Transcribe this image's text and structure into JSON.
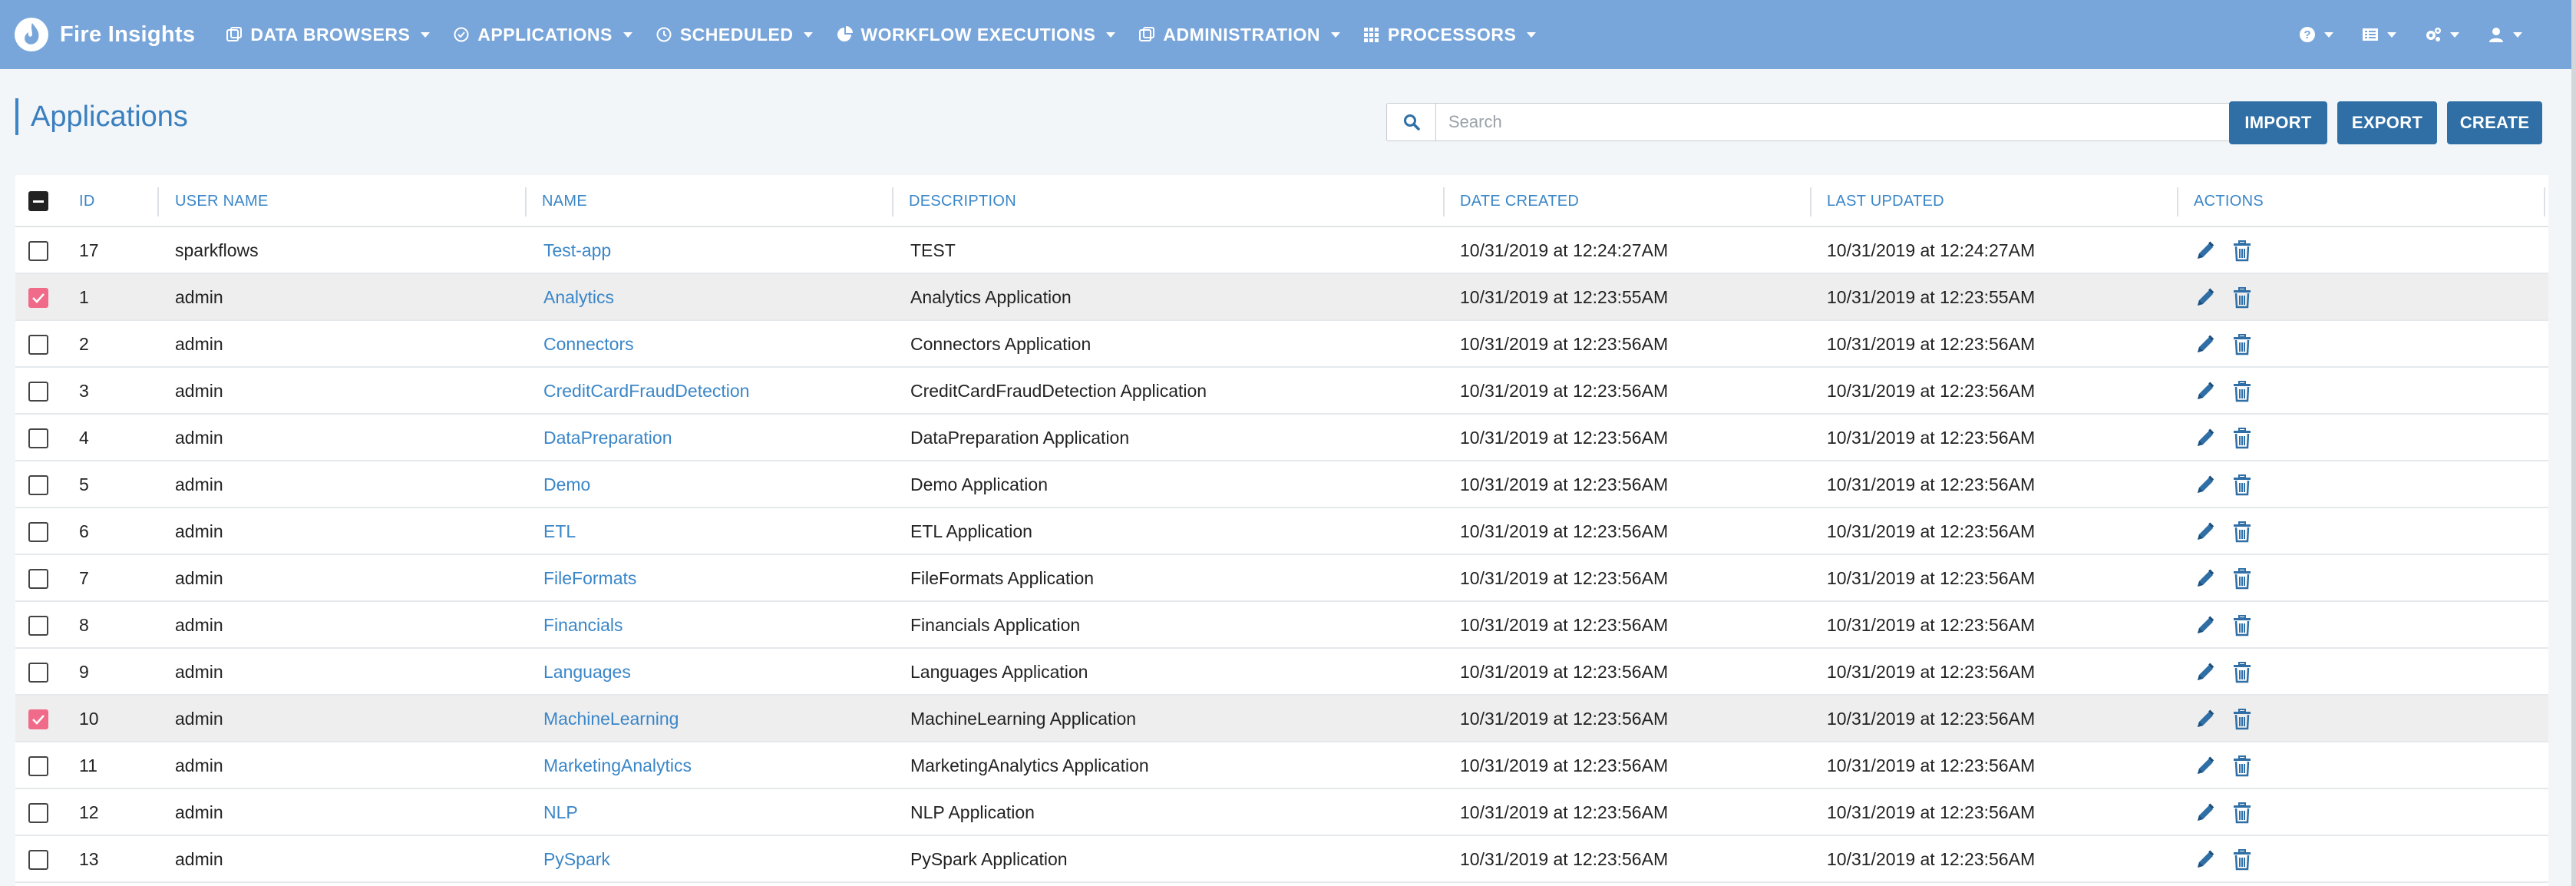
{
  "brand": {
    "name": "Fire Insights"
  },
  "nav": {
    "items": [
      {
        "label": "DATA BROWSERS",
        "icon": "data-browser-icon"
      },
      {
        "label": "APPLICATIONS",
        "icon": "applications-icon"
      },
      {
        "label": "SCHEDULED",
        "icon": "clock-icon"
      },
      {
        "label": "WORKFLOW EXECUTIONS",
        "icon": "pie-chart-icon"
      },
      {
        "label": "ADMINISTRATION",
        "icon": "admin-icon"
      },
      {
        "label": "PROCESSORS",
        "icon": "grid-icon"
      }
    ],
    "right_icons": [
      "help-icon",
      "list-icon",
      "cogs-icon",
      "user-icon"
    ]
  },
  "page": {
    "title": "Applications"
  },
  "search": {
    "placeholder": "Search",
    "value": ""
  },
  "toolbar": {
    "import_label": "IMPORT",
    "export_label": "EXPORT",
    "create_label": "CREATE"
  },
  "colors": {
    "navbar": "#79a6da",
    "accent": "#3a86c8",
    "button": "#2f6fa6",
    "checkbox_checked": "#f06b8a"
  },
  "table": {
    "columns": [
      "ID",
      "USER NAME",
      "NAME",
      "DESCRIPTION",
      "DATE CREATED",
      "LAST UPDATED",
      "ACTIONS"
    ],
    "rows": [
      {
        "id": "17",
        "user": "sparkflows",
        "name": "Test-app",
        "description": "TEST",
        "created": "10/31/2019 at 12:24:27AM",
        "updated": "10/31/2019 at 12:24:27AM",
        "checked": false
      },
      {
        "id": "1",
        "user": "admin",
        "name": "Analytics",
        "description": "Analytics Application",
        "created": "10/31/2019 at 12:23:55AM",
        "updated": "10/31/2019 at 12:23:55AM",
        "checked": true
      },
      {
        "id": "2",
        "user": "admin",
        "name": "Connectors",
        "description": "Connectors Application",
        "created": "10/31/2019 at 12:23:56AM",
        "updated": "10/31/2019 at 12:23:56AM",
        "checked": false
      },
      {
        "id": "3",
        "user": "admin",
        "name": "CreditCardFraudDetection",
        "description": "CreditCardFraudDetection Application",
        "created": "10/31/2019 at 12:23:56AM",
        "updated": "10/31/2019 at 12:23:56AM",
        "checked": false
      },
      {
        "id": "4",
        "user": "admin",
        "name": "DataPreparation",
        "description": "DataPreparation Application",
        "created": "10/31/2019 at 12:23:56AM",
        "updated": "10/31/2019 at 12:23:56AM",
        "checked": false
      },
      {
        "id": "5",
        "user": "admin",
        "name": "Demo",
        "description": "Demo Application",
        "created": "10/31/2019 at 12:23:56AM",
        "updated": "10/31/2019 at 12:23:56AM",
        "checked": false
      },
      {
        "id": "6",
        "user": "admin",
        "name": "ETL",
        "description": "ETL Application",
        "created": "10/31/2019 at 12:23:56AM",
        "updated": "10/31/2019 at 12:23:56AM",
        "checked": false
      },
      {
        "id": "7",
        "user": "admin",
        "name": "FileFormats",
        "description": "FileFormats Application",
        "created": "10/31/2019 at 12:23:56AM",
        "updated": "10/31/2019 at 12:23:56AM",
        "checked": false
      },
      {
        "id": "8",
        "user": "admin",
        "name": "Financials",
        "description": "Financials Application",
        "created": "10/31/2019 at 12:23:56AM",
        "updated": "10/31/2019 at 12:23:56AM",
        "checked": false
      },
      {
        "id": "9",
        "user": "admin",
        "name": "Languages",
        "description": "Languages Application",
        "created": "10/31/2019 at 12:23:56AM",
        "updated": "10/31/2019 at 12:23:56AM",
        "checked": false
      },
      {
        "id": "10",
        "user": "admin",
        "name": "MachineLearning",
        "description": "MachineLearning Application",
        "created": "10/31/2019 at 12:23:56AM",
        "updated": "10/31/2019 at 12:23:56AM",
        "checked": true
      },
      {
        "id": "11",
        "user": "admin",
        "name": "MarketingAnalytics",
        "description": "MarketingAnalytics Application",
        "created": "10/31/2019 at 12:23:56AM",
        "updated": "10/31/2019 at 12:23:56AM",
        "checked": false
      },
      {
        "id": "12",
        "user": "admin",
        "name": "NLP",
        "description": "NLP Application",
        "created": "10/31/2019 at 12:23:56AM",
        "updated": "10/31/2019 at 12:23:56AM",
        "checked": false
      },
      {
        "id": "13",
        "user": "admin",
        "name": "PySpark",
        "description": "PySpark Application",
        "created": "10/31/2019 at 12:23:56AM",
        "updated": "10/31/2019 at 12:23:56AM",
        "checked": false
      }
    ]
  }
}
